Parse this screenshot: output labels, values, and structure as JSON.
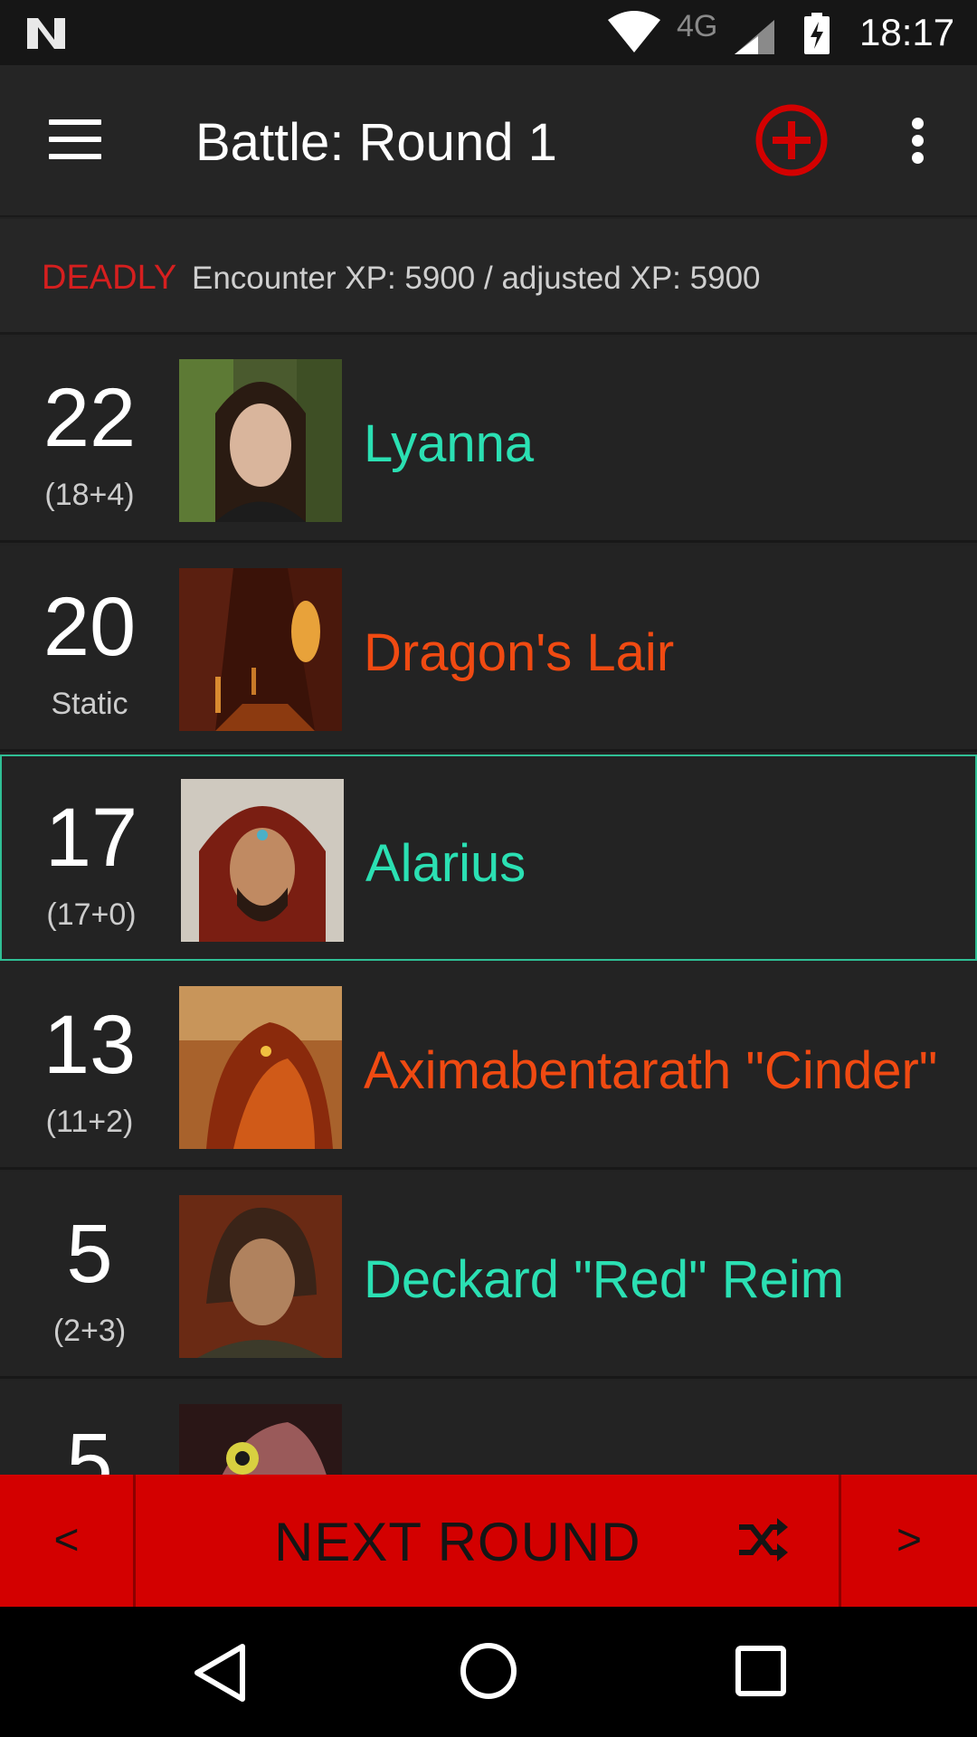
{
  "status_bar": {
    "network": "4G",
    "time": "18:17",
    "icons": [
      "n-logo-icon",
      "wifi-icon",
      "signal-icon",
      "battery-charging-icon"
    ]
  },
  "app_bar": {
    "title": "Battle: Round 1",
    "icons": [
      "menu-icon",
      "add-circle-icon",
      "more-vert-icon"
    ],
    "accent_color": "#d30000"
  },
  "encounter": {
    "difficulty": "DEADLY",
    "difficulty_color": "#d61f1f",
    "xp_text": "Encounter XP: 5900 / adjusted XP: 5900"
  },
  "combatants": [
    {
      "initiative": "22",
      "detail": "(18+4)",
      "name": "Lyanna",
      "type": "pc",
      "active": false
    },
    {
      "initiative": "20",
      "detail": "Static",
      "name": "Dragon's Lair",
      "type": "foe",
      "active": false
    },
    {
      "initiative": "17",
      "detail": "(17+0)",
      "name": "Alarius",
      "type": "pc",
      "active": true
    },
    {
      "initiative": "13",
      "detail": "(11+2)",
      "name": "Aximabentarath \"Cinder\"",
      "type": "foe",
      "active": false
    },
    {
      "initiative": "5",
      "detail": "(2+3)",
      "name": "Deckard \"Red\" Reim",
      "type": "pc",
      "active": false
    },
    {
      "initiative": "5",
      "detail": "",
      "name": "",
      "type": "pc",
      "active": false
    }
  ],
  "colors": {
    "pc_name": "#2be0b3",
    "foe_name": "#f04a12",
    "active_border": "#2fbf95"
  },
  "action_bar": {
    "prev_label": "<",
    "next_round_label": "NEXT ROUND",
    "next_label": ">",
    "icons": [
      "shuffle-icon"
    ]
  },
  "nav_bar": {
    "icons": [
      "back-icon",
      "home-icon",
      "recents-icon"
    ]
  }
}
